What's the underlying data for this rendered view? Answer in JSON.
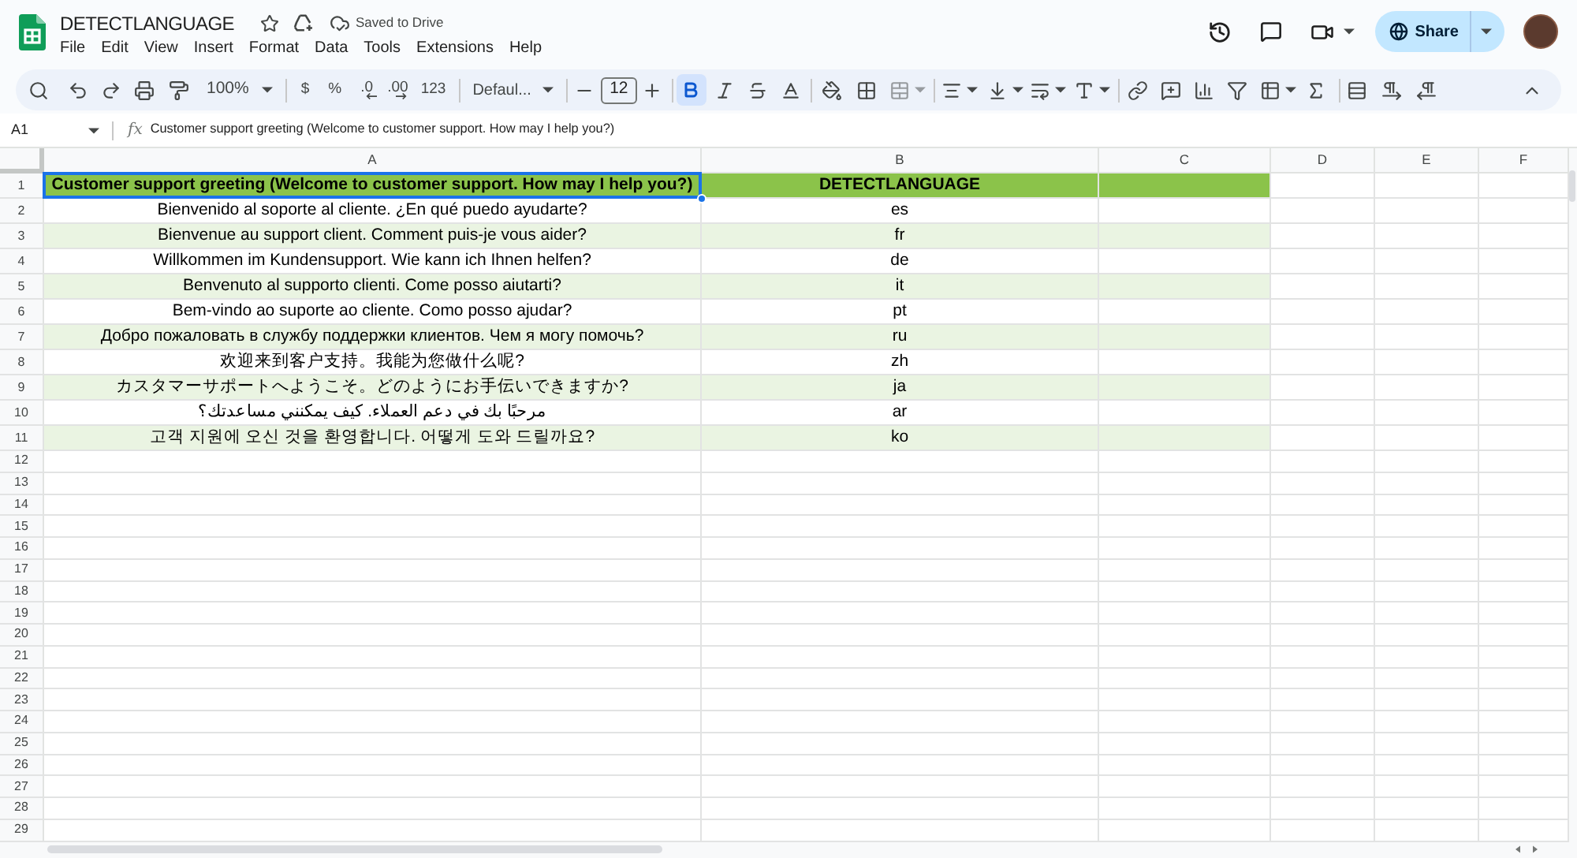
{
  "document": {
    "title": "DETECTLANGUAGE",
    "save_status": "Saved to Drive"
  },
  "menu": [
    "File",
    "Edit",
    "View",
    "Insert",
    "Format",
    "Data",
    "Tools",
    "Extensions",
    "Help"
  ],
  "share": {
    "label": "Share"
  },
  "toolbar": {
    "zoom": "100%",
    "number_formats": [
      {
        "label": "$",
        "kind": "text"
      },
      {
        "label": "%",
        "kind": "text"
      },
      {
        "label": ".0",
        "kind": "decimal_decrease"
      },
      {
        "label": ".00",
        "kind": "decimal_increase"
      },
      {
        "label": "123",
        "kind": "text"
      }
    ],
    "font": "Defaul...",
    "font_size": "12",
    "bold": true
  },
  "formula_bar": {
    "cell": "A1",
    "function_symbol": "fx",
    "content": "Customer support greeting (Welcome to customer support. How may I help you?)"
  },
  "columns": [
    "A",
    "B",
    "C",
    "D",
    "E",
    "F"
  ],
  "rows": [
    {
      "number": "1",
      "kind": "header",
      "cells": [
        {
          "text": "Customer support greeting (Welcome to customer support. How may I help you?)",
          "selected": true
        },
        {
          "text": "DETECTLANGUAGE",
          "selected": false
        }
      ]
    },
    {
      "number": "2",
      "kind": "data",
      "cells": [
        {
          "text": "Bienvenido al soporte al cliente. ¿En qué puedo ayudarte?",
          "selected": false
        },
        {
          "text": "es",
          "selected": false
        }
      ]
    },
    {
      "number": "3",
      "kind": "data",
      "cells": [
        {
          "text": "Bienvenue au support client. Comment puis-je vous aider?",
          "selected": false
        },
        {
          "text": "fr",
          "selected": false
        }
      ]
    },
    {
      "number": "4",
      "kind": "data",
      "cells": [
        {
          "text": "Willkommen im Kundensupport. Wie kann ich Ihnen helfen?",
          "selected": false
        },
        {
          "text": "de",
          "selected": false
        }
      ]
    },
    {
      "number": "5",
      "kind": "data",
      "cells": [
        {
          "text": "Benvenuto al supporto clienti. Come posso aiutarti?",
          "selected": false
        },
        {
          "text": "it",
          "selected": false
        }
      ]
    },
    {
      "number": "6",
      "kind": "data",
      "cells": [
        {
          "text": "Bem-vindo ao suporte ao cliente. Como posso ajudar?",
          "selected": false
        },
        {
          "text": "pt",
          "selected": false
        }
      ]
    },
    {
      "number": "7",
      "kind": "data",
      "cells": [
        {
          "text": "Добро пожаловать в службу поддержки клиентов. Чем я могу помочь?",
          "selected": false
        },
        {
          "text": "ru",
          "selected": false
        }
      ]
    },
    {
      "number": "8",
      "kind": "data",
      "cells": [
        {
          "text": "欢迎来到客户支持。我能为您做什么呢?",
          "selected": false
        },
        {
          "text": "zh",
          "selected": false
        }
      ]
    },
    {
      "number": "9",
      "kind": "data",
      "cells": [
        {
          "text": "カスタマーサポートへようこそ。どのようにお手伝いできますか?",
          "selected": false
        },
        {
          "text": "ja",
          "selected": false
        }
      ]
    },
    {
      "number": "10",
      "kind": "data",
      "cells": [
        {
          "text": "مرحبًا بك في دعم العملاء. كيف يمكنني مساعدتك؟",
          "selected": false
        },
        {
          "text": "ar",
          "selected": false
        }
      ]
    },
    {
      "number": "11",
      "kind": "data",
      "cells": [
        {
          "text": "고객 지원에 오신 것을 환영합니다. 어떻게 도와 드릴까요?",
          "selected": false
        },
        {
          "text": "ko",
          "selected": false
        }
      ]
    },
    {
      "number": "12",
      "kind": "empty"
    },
    {
      "number": "13",
      "kind": "empty"
    },
    {
      "number": "14",
      "kind": "empty"
    },
    {
      "number": "15",
      "kind": "empty"
    },
    {
      "number": "16",
      "kind": "empty"
    },
    {
      "number": "17",
      "kind": "empty"
    },
    {
      "number": "18",
      "kind": "empty"
    },
    {
      "number": "19",
      "kind": "empty"
    },
    {
      "number": "20",
      "kind": "empty"
    },
    {
      "number": "21",
      "kind": "empty"
    },
    {
      "number": "22",
      "kind": "empty"
    },
    {
      "number": "23",
      "kind": "empty"
    },
    {
      "number": "24",
      "kind": "empty"
    },
    {
      "number": "25",
      "kind": "empty"
    },
    {
      "number": "26",
      "kind": "empty"
    },
    {
      "number": "27",
      "kind": "empty"
    },
    {
      "number": "28",
      "kind": "empty"
    },
    {
      "number": "29",
      "kind": "empty"
    }
  ]
}
